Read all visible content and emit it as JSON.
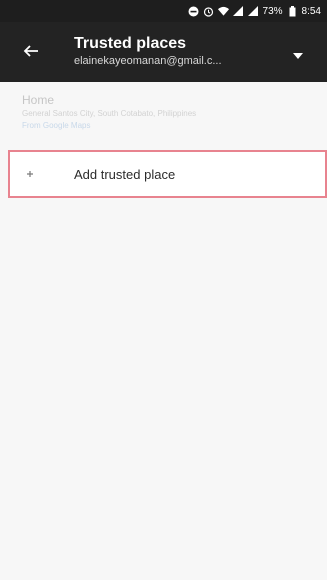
{
  "status_bar": {
    "battery_percent": "73%",
    "time": "8:54",
    "icons": [
      "do-not-disturb-icon",
      "alarm-icon",
      "wifi-icon",
      "signal-icon",
      "signal-icon",
      "battery-icon"
    ]
  },
  "app_bar": {
    "title": "Trusted places",
    "account_email": "elainekayeomanan@gmail.c...",
    "back_icon": "arrow-back-icon",
    "dropdown_icon": "caret-down-icon"
  },
  "places": [
    {
      "name": "Home",
      "address": "General Santos City, South Cotabato, Philippines",
      "source": "From Google Maps"
    }
  ],
  "add_place": {
    "label": "Add trusted place",
    "icon": "plus-icon",
    "highlight_color": "#e8838f"
  },
  "colors": {
    "app_bar": "#232323",
    "status_bar": "#1e1e1e",
    "background": "#f7f7f7"
  }
}
